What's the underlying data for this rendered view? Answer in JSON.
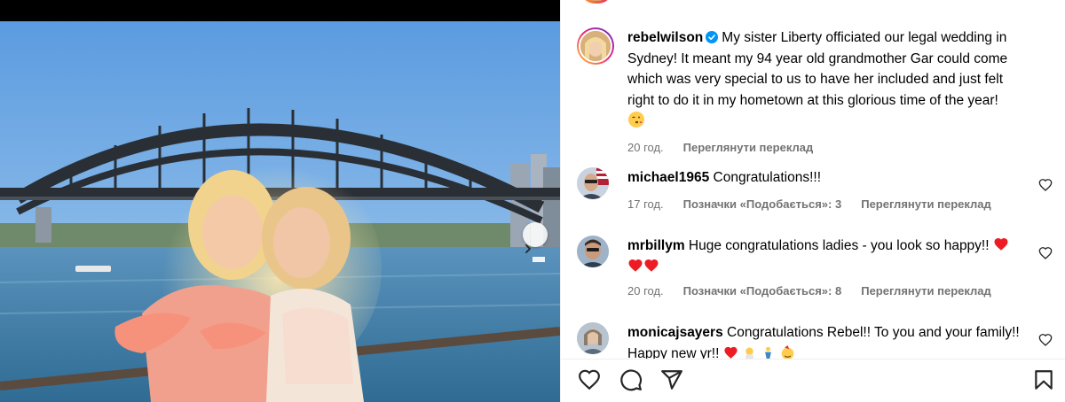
{
  "post": {
    "author": "rebelwilson",
    "caption": "My sister Liberty officiated our legal wedding in Sydney! It meant my 94 year old grandmother Gar could come which was very special to us to have her included and just felt right to do it in my hometown at this glorious time of the year!",
    "time": "20 год.",
    "translate_label": "Переглянути переклад",
    "verified": true
  },
  "comments": [
    {
      "username": "michael1965",
      "text": "Congratulations!!!",
      "time": "17 год.",
      "likes_label": "Позначки «Подобається»: 3",
      "translate_label": "Переглянути переклад"
    },
    {
      "username": "mrbillym",
      "text": "Huge congratulations ladies - you look so happy!!",
      "time": "20 год.",
      "likes_label": "Позначки «Подобається»: 8",
      "translate_label": "Переглянути переклад"
    },
    {
      "username": "monicajsayers",
      "text": "Congratulations Rebel!! To you and your family!!",
      "text_cont": "Happy new yr!!"
    }
  ],
  "icons": {
    "verified": "verified-badge-icon",
    "like": "heart-outline-icon",
    "comment": "comment-bubble-icon",
    "share": "paper-plane-icon",
    "save": "bookmark-icon",
    "next": "chevron-right-icon"
  },
  "colors": {
    "verified_blue": "#0095f6",
    "muted_text": "#737373",
    "emoji_heart": "#ed1c24"
  }
}
